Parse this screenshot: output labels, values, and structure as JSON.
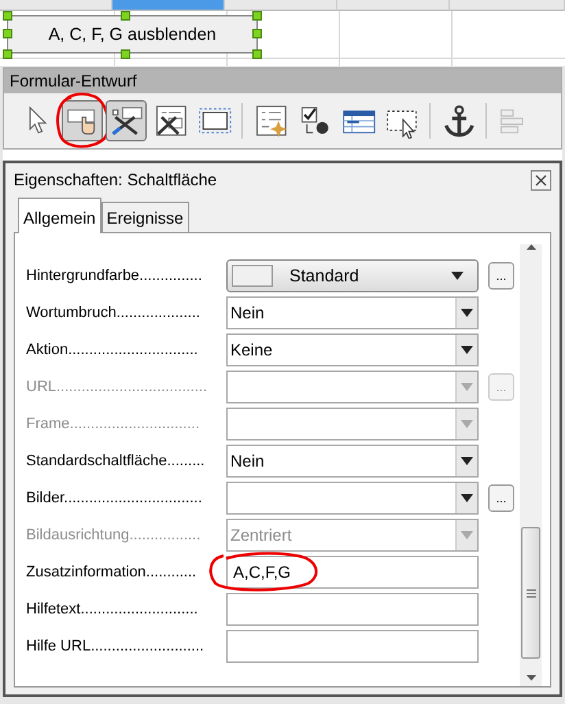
{
  "sheet": {
    "button_label": "A, C, F, G ausblenden",
    "button_selected": true
  },
  "toolbar": {
    "title": "Formular-Entwurf",
    "items": [
      {
        "kind": "pointer",
        "selected": false,
        "circled": false
      },
      {
        "kind": "push-button",
        "selected": true,
        "circled": true
      },
      {
        "kind": "design-mode",
        "selected": true,
        "circled": false
      },
      {
        "kind": "wizard",
        "selected": false,
        "circled": false
      },
      {
        "kind": "frame",
        "selected": false,
        "circled": false
      },
      {
        "kind": "separator"
      },
      {
        "kind": "form-properties",
        "selected": false,
        "circled": false
      },
      {
        "kind": "tab-order",
        "selected": false,
        "circled": false
      },
      {
        "kind": "navigator",
        "selected": false,
        "circled": false
      },
      {
        "kind": "selection",
        "selected": false,
        "circled": false
      },
      {
        "kind": "separator"
      },
      {
        "kind": "anchor",
        "selected": false,
        "circled": false
      },
      {
        "kind": "separator"
      },
      {
        "kind": "align",
        "selected": false,
        "circled": false
      }
    ]
  },
  "dialog": {
    "title": "Eigenschaften: Schaltfläche",
    "tabs": [
      {
        "label": "Allgemein",
        "selected": true
      },
      {
        "label": "Ereignisse",
        "selected": false
      }
    ],
    "properties": [
      {
        "label": "Hintergrundfarbe...............",
        "kind": "color",
        "value": "Standard",
        "disabled": false,
        "more_label": "...",
        "circled": false
      },
      {
        "label": "Wortumbruch....................",
        "kind": "select",
        "value": "Nein",
        "disabled": false,
        "circled": false
      },
      {
        "label": "Aktion...............................",
        "kind": "select",
        "value": "Keine",
        "disabled": false,
        "circled": false
      },
      {
        "label": "URL....................................",
        "kind": "select",
        "disabled": true,
        "more_label": "...",
        "circled": false
      },
      {
        "label": "Frame...............................",
        "kind": "select",
        "disabled": true,
        "circled": false
      },
      {
        "label": "Standardschaltfläche.........",
        "kind": "select",
        "value": "Nein",
        "disabled": false,
        "circled": false
      },
      {
        "label": "Bilder.................................",
        "kind": "select",
        "disabled": false,
        "more_label": "...",
        "circled": false
      },
      {
        "label": "Bildausrichtung.................",
        "kind": "select",
        "value": "Zentriert",
        "disabled": true,
        "circled": false
      },
      {
        "label": "Zusatzinformation............",
        "kind": "text",
        "value": "A,C,F,G",
        "disabled": false,
        "circled": true
      },
      {
        "label": "Hilfetext............................",
        "kind": "text",
        "disabled": false,
        "circled": false
      },
      {
        "label": "Hilfe URL...........................",
        "kind": "text",
        "disabled": false,
        "circled": false
      }
    ]
  }
}
